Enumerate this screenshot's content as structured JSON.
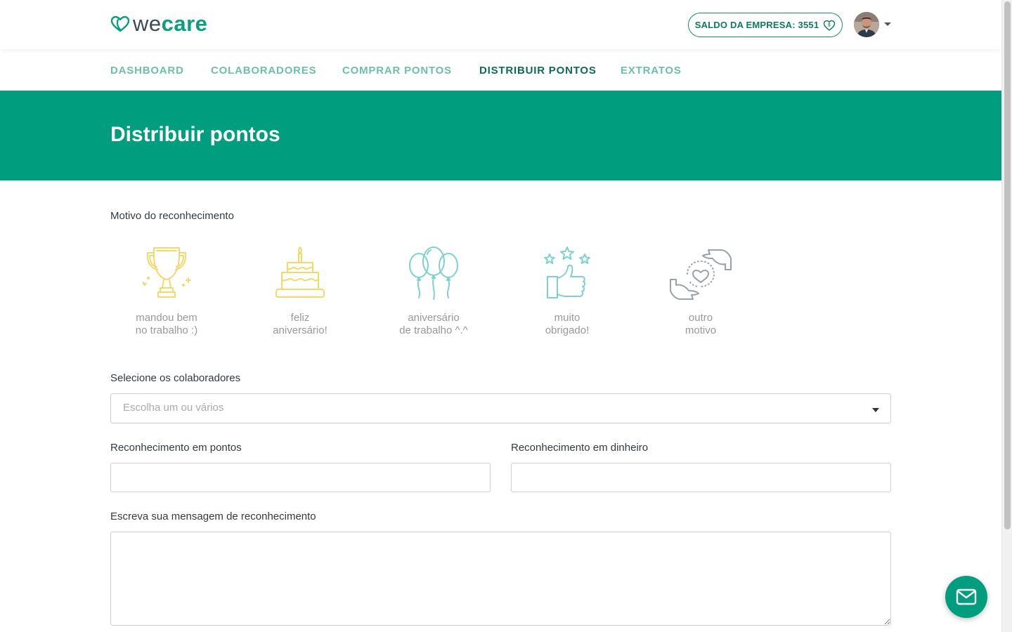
{
  "header": {
    "logo_we": "we",
    "logo_care": "care",
    "balance_label": "SALDO DA EMPRESA: 3551"
  },
  "nav": {
    "items": [
      {
        "label": "DASHBOARD",
        "active": false
      },
      {
        "label": "COLABORADORES",
        "active": false
      },
      {
        "label": "COMPRAR PONTOS",
        "active": false
      },
      {
        "label": "DISTRIBUIR PONTOS",
        "active": true
      },
      {
        "label": "EXTRATOS",
        "active": false
      }
    ]
  },
  "page": {
    "title": "Distribuir pontos"
  },
  "form": {
    "reason_label": "Motivo do reconhecimento",
    "reasons": [
      {
        "line1": "mandou bem",
        "line2": "no trabalho :)",
        "icon": "trophy-icon",
        "color": "#f2d96b"
      },
      {
        "line1": "feliz",
        "line2": "aniversário!",
        "icon": "birthday-cake-icon",
        "color": "#f2d96b"
      },
      {
        "line1": "aniversário",
        "line2": "de trabalho ^.^",
        "icon": "balloons-icon",
        "color": "#7dd3cc"
      },
      {
        "line1": "muito",
        "line2": "obrigado!",
        "icon": "thumbs-up-stars-icon",
        "color": "#7dd3cc"
      },
      {
        "line1": "outro",
        "line2": "motivo",
        "icon": "hands-heart-icon",
        "color": "#9aa1a8"
      }
    ],
    "collaborators_label": "Selecione os colaboradores",
    "collaborators_placeholder": "Escolha um ou vários",
    "points_label": "Reconhecimento em pontos",
    "points_value": "",
    "money_label": "Reconhecimento em dinheiro",
    "money_value": "",
    "message_label": "Escreva sua mensagem de reconhecimento",
    "message_value": ""
  },
  "colors": {
    "brand_green": "#009e7e",
    "nav_inactive": "#6ebfa8",
    "nav_active": "#0e6a53"
  }
}
